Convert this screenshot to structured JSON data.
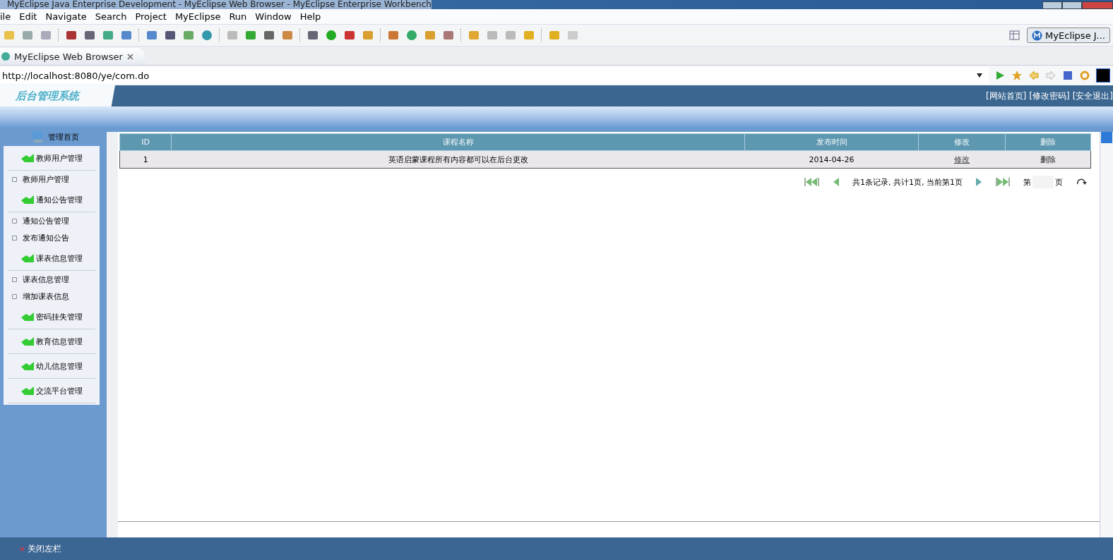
{
  "window": {
    "title": "MyEclipse Java Enterprise Development - MyEclipse Web Browser - MyEclipse Enterprise Workbench"
  },
  "menu": [
    "ile",
    "Edit",
    "Navigate",
    "Search",
    "Project",
    "MyEclipse",
    "Run",
    "Window",
    "Help"
  ],
  "perspective": {
    "label": "MyEclipse J..."
  },
  "editor_tab": {
    "label": "MyEclipse Web Browser",
    "selected": true
  },
  "address_bar": {
    "value": "http://localhost:8080/ye/com.do"
  },
  "page": {
    "logo": "后台管理系统",
    "header_links": [
      "[网站首页]",
      "[修改密码]",
      "[安全退出]"
    ],
    "sidebar": {
      "home": "管理首页",
      "groups": [
        {
          "label": "教师用户管理",
          "items": [
            "教师用户管理"
          ]
        },
        {
          "label": "通知公告管理",
          "items": [
            "通知公告管理",
            "发布通知公告"
          ]
        },
        {
          "label": "课表信息管理",
          "items": [
            "课表信息管理",
            "增加课表信息"
          ]
        },
        {
          "label": "密码挂失管理"
        },
        {
          "label": "教育信息管理"
        },
        {
          "label": "幼儿信息管理"
        },
        {
          "label": "交流平台管理"
        }
      ]
    },
    "table": {
      "columns": [
        "ID",
        "课程名称",
        "发布时间",
        "修改",
        "删除"
      ],
      "rows": [
        {
          "id": "1",
          "name": "英语启蒙课程所有内容都可以在后台更改",
          "date": "2014-04-26",
          "edit": "修改",
          "delete": "删除"
        }
      ]
    },
    "pagination": {
      "summary": "共1条记录, 共计1页, 当前第1页",
      "page_prefix": "第",
      "page_suffix": "页"
    },
    "footer": {
      "close_sidebar": "关闭左栏"
    }
  }
}
